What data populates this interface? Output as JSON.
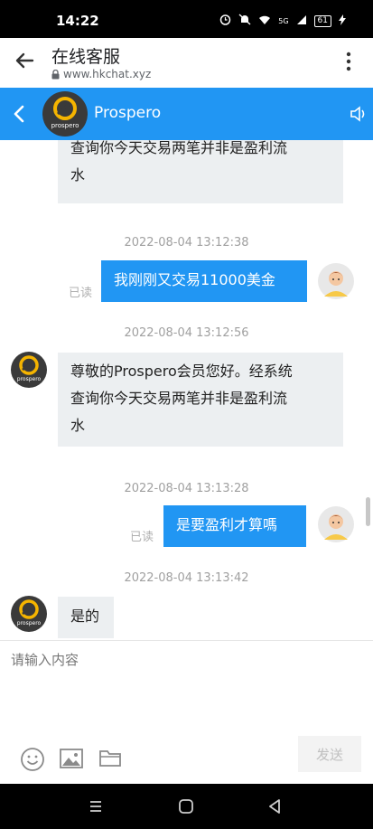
{
  "status_bar": {
    "time": "14:22",
    "network": "5G",
    "battery": "61",
    "icons": [
      "alarm-icon",
      "mute-icon",
      "wifi-icon",
      "signal-icon",
      "battery-icon",
      "charging-icon"
    ]
  },
  "browser": {
    "title": "在线客服",
    "url": "www.hkchat.xyz"
  },
  "chat_header": {
    "name": "Prospero",
    "accent_color": "#2196f3"
  },
  "messages": [
    {
      "type": "in",
      "text": "查询你今天交易两笔并非是盈利流水",
      "lines": [
        "查询你今天交易两笔并非是盈利流",
        "水"
      ]
    },
    {
      "type": "timestamp",
      "text": "2022-08-04 13:12:38"
    },
    {
      "type": "out",
      "text": "我刚刚又交易11000美金",
      "status": "已读"
    },
    {
      "type": "timestamp",
      "text": "2022-08-04 13:12:56"
    },
    {
      "type": "in",
      "text": "尊敬的Prospero会员您好。经系统查询你今天交易两笔并非是盈利流水",
      "lines": [
        "尊敬的Prospero会员您好。经系统",
        "查询你今天交易两笔并非是盈利流",
        "水"
      ]
    },
    {
      "type": "timestamp",
      "text": "2022-08-04 13:13:28"
    },
    {
      "type": "out",
      "text": "是要盈利才算嗎",
      "status": "已读"
    },
    {
      "type": "timestamp",
      "text": "2022-08-04 13:13:42"
    },
    {
      "type": "in",
      "text": "是的"
    }
  ],
  "composer": {
    "placeholder": "请输入内容",
    "value": "",
    "send_label": "发送",
    "tools": [
      "emoji-icon",
      "image-icon",
      "folder-icon"
    ]
  },
  "avatar_text": "prospero"
}
